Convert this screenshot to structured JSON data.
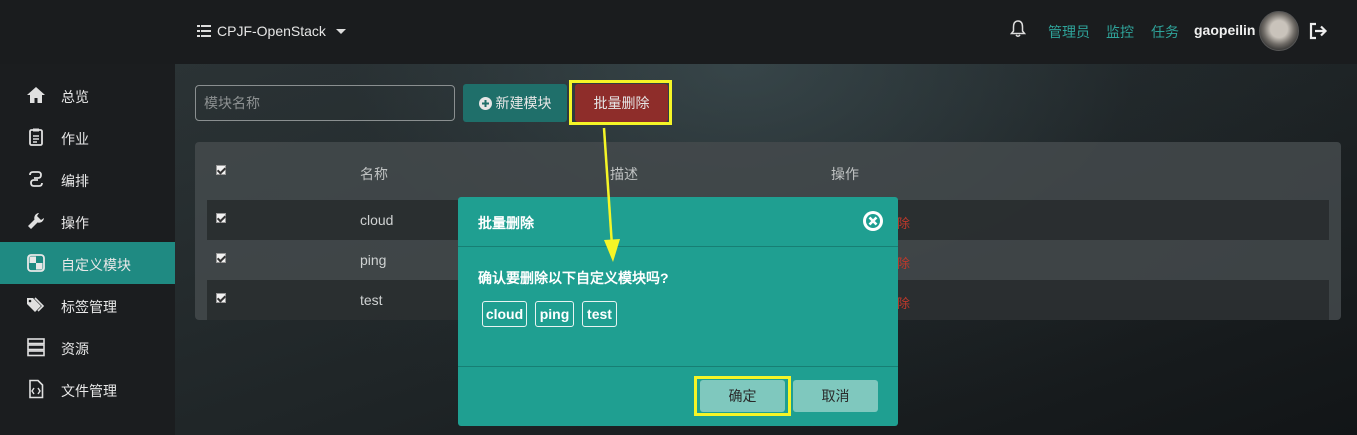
{
  "header": {
    "project": "CPJF-OpenStack",
    "links": [
      "管理员",
      "监控",
      "任务"
    ],
    "username": "gaopeilin"
  },
  "sidebar": {
    "items": [
      {
        "label": "总览",
        "icon": "home-icon"
      },
      {
        "label": "作业",
        "icon": "clipboard-icon"
      },
      {
        "label": "编排",
        "icon": "link-icon"
      },
      {
        "label": "操作",
        "icon": "wrench-icon"
      },
      {
        "label": "自定义模块",
        "icon": "module-icon",
        "active": true
      },
      {
        "label": "标签管理",
        "icon": "tags-icon"
      },
      {
        "label": "资源",
        "icon": "server-icon"
      },
      {
        "label": "文件管理",
        "icon": "file-code-icon"
      }
    ]
  },
  "toolbar": {
    "search_placeholder": "模块名称",
    "new_label": "新建模块",
    "bulk_delete_label": "批量删除"
  },
  "table": {
    "headers": [
      "名称",
      "描述",
      "操作"
    ],
    "rows": [
      {
        "name": "cloud",
        "action_fragment": "除"
      },
      {
        "name": "ping",
        "action_fragment": "除"
      },
      {
        "name": "test",
        "action_fragment": "除"
      }
    ]
  },
  "modal": {
    "title": "批量删除",
    "message": "确认要删除以下自定义模块吗?",
    "tags": [
      "cloud",
      "ping",
      "test"
    ],
    "ok_label": "确定",
    "cancel_label": "取消"
  },
  "colors": {
    "accent": "#1f9f91",
    "active_nav": "#1f8a82",
    "danger": "#8e2d2a",
    "highlight": "#f5f527"
  }
}
